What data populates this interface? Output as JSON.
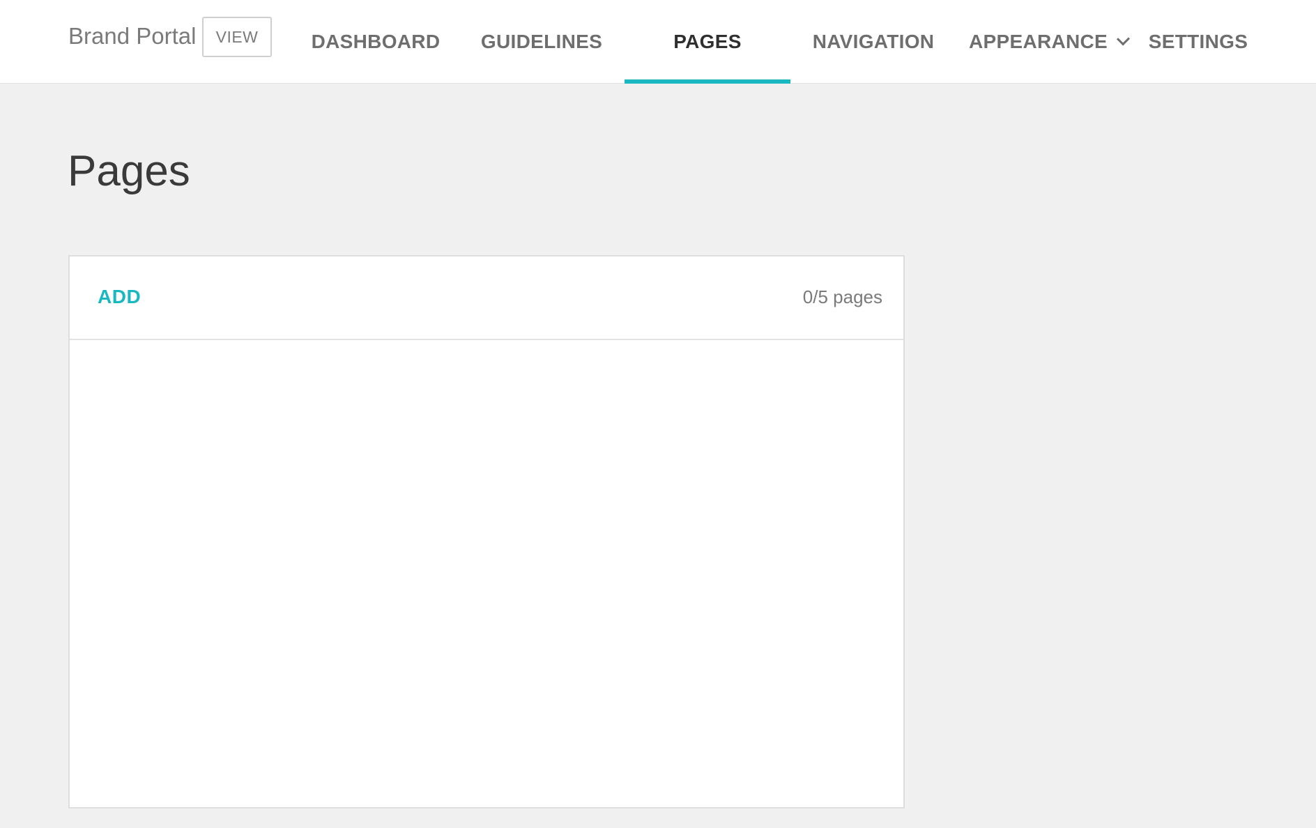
{
  "header": {
    "brand": "Brand Portal",
    "view_label": "VIEW",
    "nav": [
      {
        "label": "DASHBOARD"
      },
      {
        "label": "GUIDELINES"
      },
      {
        "label": "PAGES",
        "active": true
      },
      {
        "label": "NAVIGATION"
      },
      {
        "label": "APPEARANCE",
        "icon": "chevron-down-icon"
      },
      {
        "label": "SETTINGS"
      }
    ]
  },
  "main": {
    "title": "Pages",
    "panel": {
      "add_label": "ADD",
      "count": "0/5 pages"
    }
  },
  "colors": {
    "accent": "#19b8c0",
    "background": "#f0f0f0"
  }
}
